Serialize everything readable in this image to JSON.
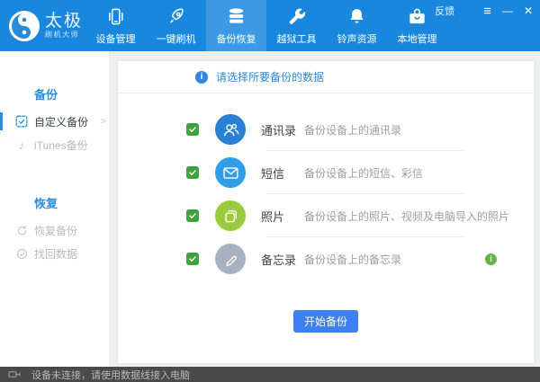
{
  "titlebar": {
    "brand": {
      "name_main": "太极",
      "name_sub": "刷机大师"
    },
    "feedback": "反馈",
    "controls": {
      "menu_icon": "≡",
      "minimize_icon": "—",
      "close_icon": "✕"
    }
  },
  "nav": {
    "items": [
      {
        "label": "设备管理",
        "icon": "phone-icon",
        "active": false
      },
      {
        "label": "一键刷机",
        "icon": "rocket-icon",
        "active": false
      },
      {
        "label": "备份恢复",
        "icon": "database-icon",
        "active": true
      },
      {
        "label": "越狱工具",
        "icon": "wrench-icon",
        "active": false
      },
      {
        "label": "铃声资源",
        "icon": "bell-icon",
        "active": false
      },
      {
        "label": "本地管理",
        "icon": "toolbox-icon",
        "active": false
      }
    ]
  },
  "sidebar": {
    "chevron": ">",
    "music_glyph": "♪",
    "sections": [
      {
        "title": "备份",
        "items": [
          {
            "label": "自定义备份",
            "icon": "custom-backup-icon",
            "active": true
          },
          {
            "label": "iTunes备份",
            "icon": "music-note-icon",
            "active": false
          }
        ]
      },
      {
        "title": "恢复",
        "items": [
          {
            "label": "恢复备份",
            "icon": "restore-icon",
            "active": false
          },
          {
            "label": "找回数据",
            "icon": "recover-data-icon",
            "active": false
          }
        ]
      }
    ]
  },
  "main": {
    "prompt": "请选择所要备份的数据",
    "rows": [
      {
        "title": "通讯录",
        "desc": "备份设备上的通讯录",
        "checked": true,
        "icon": "contacts-icon",
        "color": "#2b80d6"
      },
      {
        "title": "短信",
        "desc": "备份设备上的短信、彩信",
        "checked": true,
        "icon": "sms-icon",
        "color": "#2f9de8"
      },
      {
        "title": "照片",
        "desc": "备份设备上的照片、视频及电脑导入的照片",
        "checked": true,
        "icon": "photos-icon",
        "color": "#9bcb3e"
      },
      {
        "title": "备忘录",
        "desc": "备份设备上的备忘录",
        "checked": true,
        "icon": "memo-icon",
        "color": "#a9b2bc",
        "info_badge": true
      }
    ],
    "start_button": "开始备份"
  },
  "statusbar": {
    "text": "设备未连接，请使用数据线接入电脑",
    "icon": "usb-cable-icon"
  },
  "colors": {
    "header_blue": "#1a87de",
    "active_tab_blue": "#3c99e4",
    "accent_blue": "#2e8fe2",
    "checkbox_green": "#3ba43e",
    "info_green": "#63b53e",
    "button_blue": "#3e80f2",
    "statusbar_gray": "#4a4a4a"
  }
}
